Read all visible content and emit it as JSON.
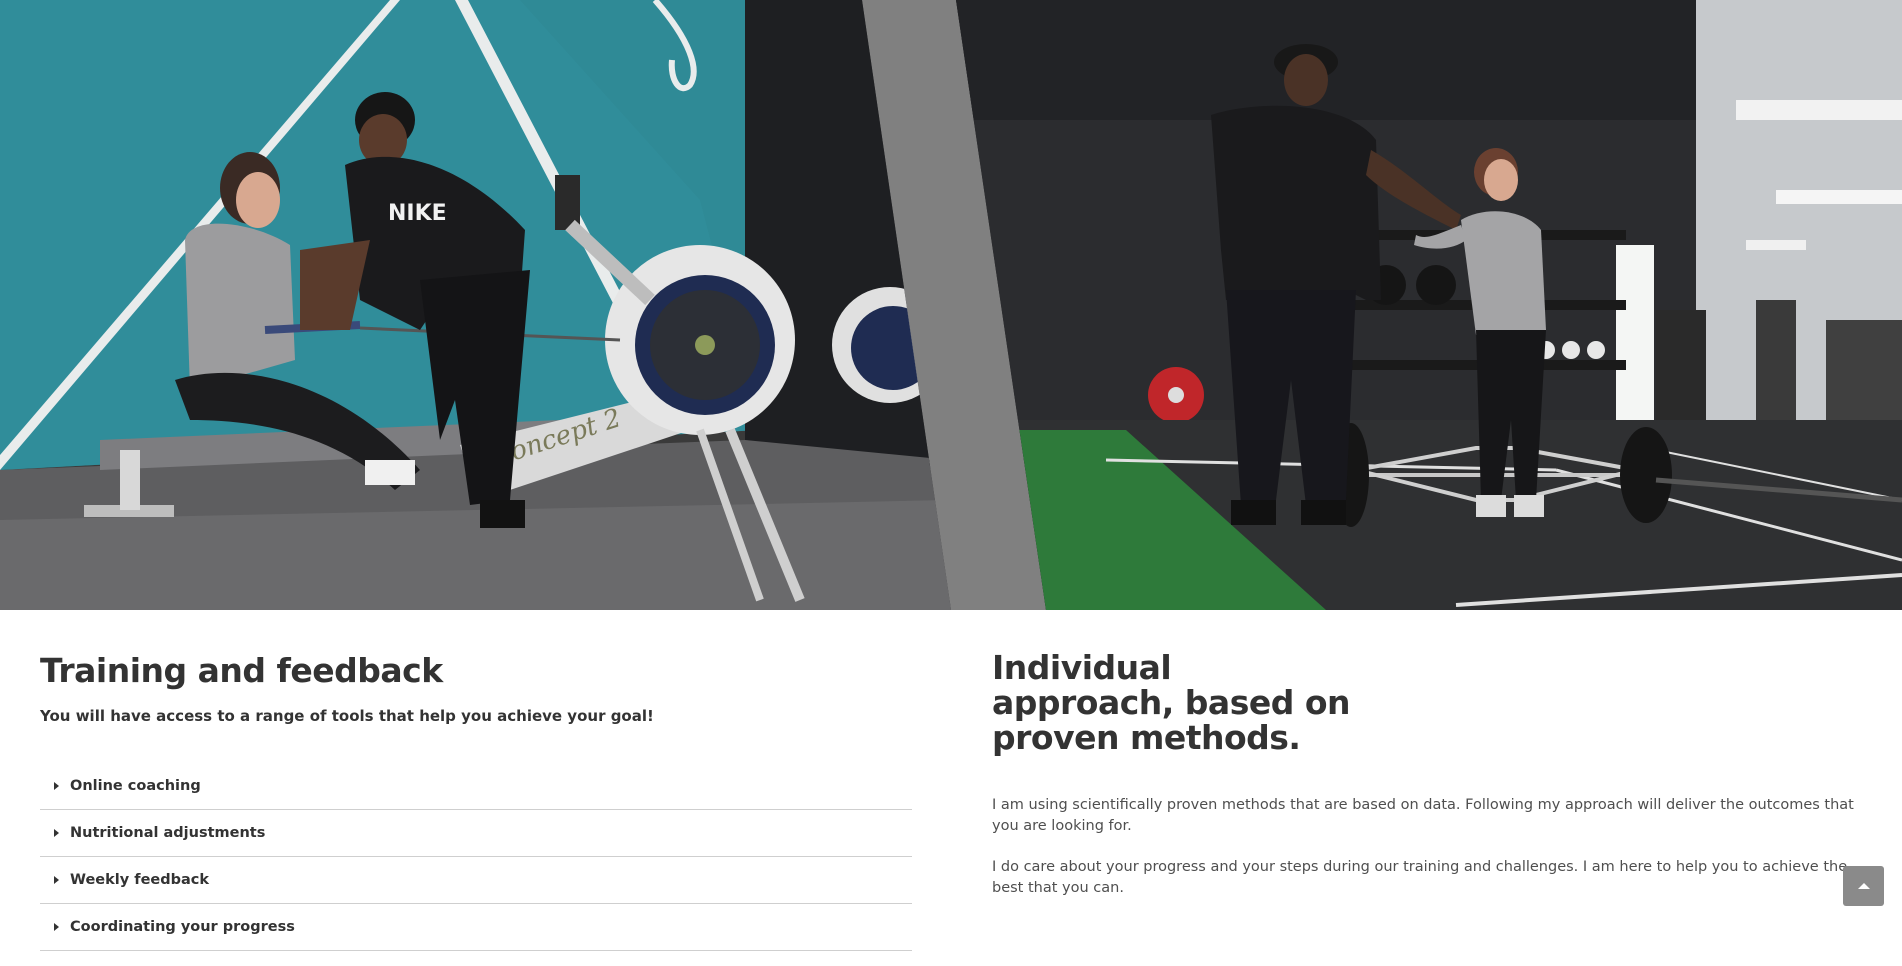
{
  "hero": {
    "left_photo": {
      "description_icon": "rowing-coach-photo",
      "brand_text": "concept 2"
    },
    "right_photo": {
      "description_icon": "gym-handshake-photo"
    }
  },
  "training": {
    "title": "Training and feedback",
    "subtitle": "You will have access to a range of tools that help you achieve your goal!",
    "items": [
      {
        "label": "Online coaching"
      },
      {
        "label": "Nutritional adjustments"
      },
      {
        "label": "Weekly feedback"
      },
      {
        "label": "Coordinating your progress"
      }
    ]
  },
  "approach": {
    "title": "Individual approach, based on proven methods.",
    "paragraphs": [
      "I am using scientifically proven methods that are based on data. Following my approach will deliver the outcomes that you are looking for.",
      "I do care about your progress and your steps during our training and challenges. I am here to help you to achieve the best that you can."
    ]
  },
  "colors": {
    "text": "#333333",
    "divider": "#cfcfcf",
    "teal_wall": "#2f8a96",
    "gym_green": "#2e7a3a",
    "back_to_top": "#8a8a8a"
  },
  "icons": {
    "accordion": "caret-right-icon",
    "back_to_top": "arrow-up-icon"
  }
}
